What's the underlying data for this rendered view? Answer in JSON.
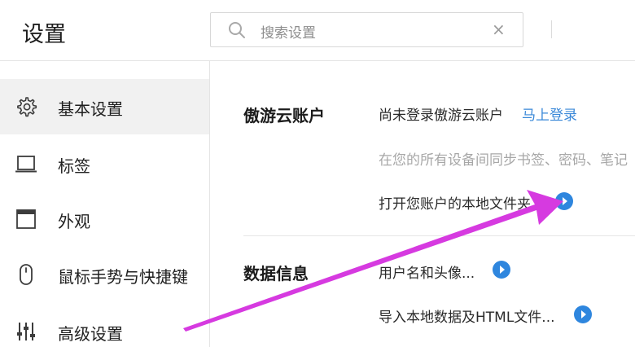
{
  "header": {
    "title": "设置",
    "search_placeholder": "搜索设置",
    "clear_symbol": "×"
  },
  "sidebar": {
    "items": [
      {
        "label": "基本设置",
        "icon": "gear-icon",
        "active": true
      },
      {
        "label": "标签",
        "icon": "laptop-icon",
        "active": false
      },
      {
        "label": "外观",
        "icon": "window-icon",
        "active": false
      },
      {
        "label": "鼠标手势与快捷键",
        "icon": "mouse-icon",
        "active": false
      },
      {
        "label": "高级设置",
        "icon": "sliders-icon",
        "active": false
      }
    ]
  },
  "main": {
    "sections": [
      {
        "title": "傲游云账户",
        "status": "尚未登录傲游云账户",
        "login_link": "马上登录",
        "description": "在您的所有设备间同步书签、密码、笔记",
        "open_folder": "打开您账户的本地文件夹"
      },
      {
        "title": "数据信息",
        "username_avatar": "用户名和头像...",
        "import_data": "导入本地数据及HTML文件..."
      }
    ]
  },
  "colors": {
    "accent": "#2e86de",
    "link": "#3a88d8",
    "arrow": "#d63ae0",
    "sidebar_active_bg": "#f1f1f1"
  }
}
